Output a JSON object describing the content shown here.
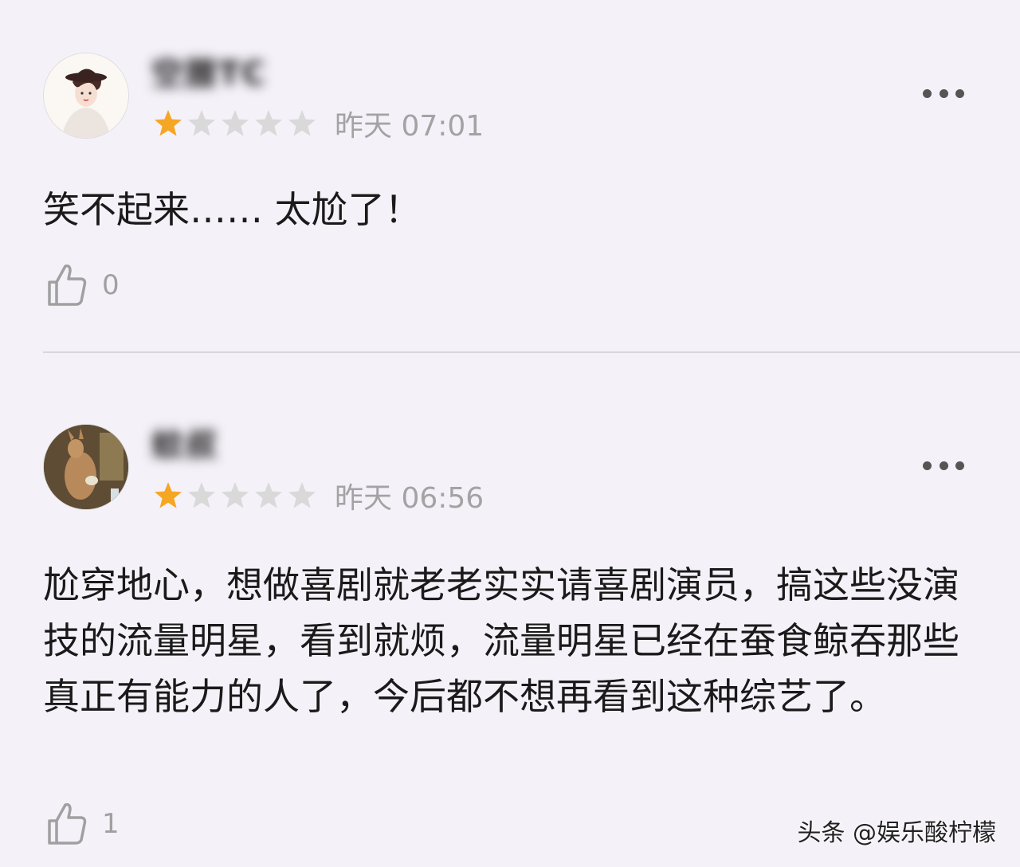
{
  "comments": [
    {
      "username": "空腊TC",
      "rating": 1,
      "rating_max": 5,
      "time": "昨天 07:01",
      "text": "笑不起来…… 太尬了！",
      "likes": "0"
    },
    {
      "username": "蚊叔",
      "rating": 1,
      "rating_max": 5,
      "time": "昨天 06:56",
      "text": "尬穿地心，想做喜剧就老老实实请喜剧演员，搞这些没演技的流量明星，看到就烦，流量明星已经在蚕食鲸吞那些真正有能力的人了，今后都不想再看到这种综艺了。",
      "likes": "1"
    }
  ],
  "watermark": "头条 @娱乐酸柠檬",
  "colors": {
    "background": "#f5f1f8",
    "star_filled": "#f5a623",
    "star_empty": "#d9d9d9",
    "muted_text": "#a3a3a3"
  },
  "icons": {
    "like": "thumbs-up-icon",
    "more": "more-dots-icon",
    "star": "star-icon"
  }
}
